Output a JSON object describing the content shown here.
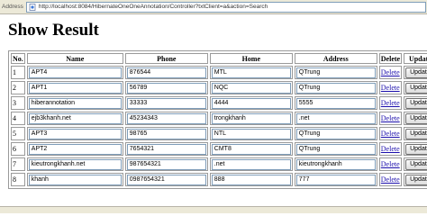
{
  "browser": {
    "address_label": "Address",
    "url": "http://localhost:8084/HibernateOneOneAnnotation/Controller?txtClient=a&action=Search"
  },
  "page": {
    "title": "Show Result"
  },
  "table": {
    "headers": {
      "no": "No.",
      "name": "Name",
      "phone": "Phone",
      "home": "Home",
      "address": "Address",
      "delete": "Delete",
      "update": "Update"
    },
    "rows": [
      {
        "no": "1",
        "name": "APT4",
        "phone": "876544",
        "home": "MTL",
        "address": "QTrung",
        "delete": "Delete",
        "update": "Update"
      },
      {
        "no": "2",
        "name": "APT1",
        "phone": "56789",
        "home": "NQC",
        "address": "QTrung",
        "delete": "Delete",
        "update": "Update"
      },
      {
        "no": "3",
        "name": "hiberannotation",
        "phone": "33333",
        "home": "4444",
        "address": "5555",
        "delete": "Delete",
        "update": "Update"
      },
      {
        "no": "4",
        "name": "ejb3khanh.net",
        "phone": "45234343",
        "home": "trongkhanh",
        "address": ".net",
        "delete": "Delete",
        "update": "Update"
      },
      {
        "no": "5",
        "name": "APT3",
        "phone": "98765",
        "home": "NTL",
        "address": "QTrung",
        "delete": "Delete",
        "update": "Update"
      },
      {
        "no": "6",
        "name": "APT2",
        "phone": "7654321",
        "home": "CMT8",
        "address": "QTrung",
        "delete": "Delete",
        "update": "Update"
      },
      {
        "no": "7",
        "name": "kieutrongkhanh.net",
        "phone": "987654321",
        "home": ".net",
        "address": "kieutrongkhanh",
        "delete": "Delete",
        "update": "Update"
      },
      {
        "no": "8",
        "name": "khanh",
        "phone": "0987654321",
        "home": "888",
        "address": "777",
        "delete": "Delete",
        "update": "Update"
      }
    ]
  }
}
